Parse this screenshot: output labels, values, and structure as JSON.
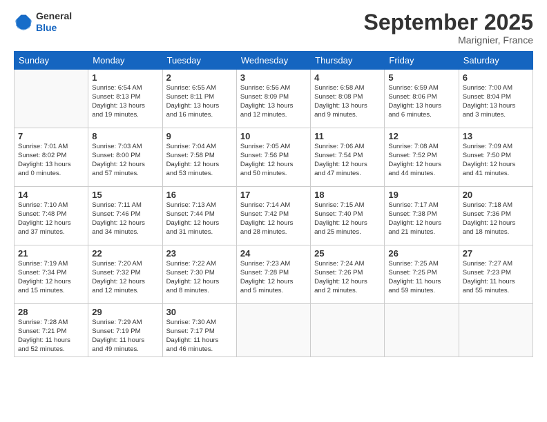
{
  "header": {
    "logo_line1": "General",
    "logo_line2": "Blue",
    "month_title": "September 2025",
    "subtitle": "Marignier, France"
  },
  "days_of_week": [
    "Sunday",
    "Monday",
    "Tuesday",
    "Wednesday",
    "Thursday",
    "Friday",
    "Saturday"
  ],
  "weeks": [
    [
      {
        "day": "",
        "info": ""
      },
      {
        "day": "1",
        "info": "Sunrise: 6:54 AM\nSunset: 8:13 PM\nDaylight: 13 hours\nand 19 minutes."
      },
      {
        "day": "2",
        "info": "Sunrise: 6:55 AM\nSunset: 8:11 PM\nDaylight: 13 hours\nand 16 minutes."
      },
      {
        "day": "3",
        "info": "Sunrise: 6:56 AM\nSunset: 8:09 PM\nDaylight: 13 hours\nand 12 minutes."
      },
      {
        "day": "4",
        "info": "Sunrise: 6:58 AM\nSunset: 8:08 PM\nDaylight: 13 hours\nand 9 minutes."
      },
      {
        "day": "5",
        "info": "Sunrise: 6:59 AM\nSunset: 8:06 PM\nDaylight: 13 hours\nand 6 minutes."
      },
      {
        "day": "6",
        "info": "Sunrise: 7:00 AM\nSunset: 8:04 PM\nDaylight: 13 hours\nand 3 minutes."
      }
    ],
    [
      {
        "day": "7",
        "info": "Sunrise: 7:01 AM\nSunset: 8:02 PM\nDaylight: 13 hours\nand 0 minutes."
      },
      {
        "day": "8",
        "info": "Sunrise: 7:03 AM\nSunset: 8:00 PM\nDaylight: 12 hours\nand 57 minutes."
      },
      {
        "day": "9",
        "info": "Sunrise: 7:04 AM\nSunset: 7:58 PM\nDaylight: 12 hours\nand 53 minutes."
      },
      {
        "day": "10",
        "info": "Sunrise: 7:05 AM\nSunset: 7:56 PM\nDaylight: 12 hours\nand 50 minutes."
      },
      {
        "day": "11",
        "info": "Sunrise: 7:06 AM\nSunset: 7:54 PM\nDaylight: 12 hours\nand 47 minutes."
      },
      {
        "day": "12",
        "info": "Sunrise: 7:08 AM\nSunset: 7:52 PM\nDaylight: 12 hours\nand 44 minutes."
      },
      {
        "day": "13",
        "info": "Sunrise: 7:09 AM\nSunset: 7:50 PM\nDaylight: 12 hours\nand 41 minutes."
      }
    ],
    [
      {
        "day": "14",
        "info": "Sunrise: 7:10 AM\nSunset: 7:48 PM\nDaylight: 12 hours\nand 37 minutes."
      },
      {
        "day": "15",
        "info": "Sunrise: 7:11 AM\nSunset: 7:46 PM\nDaylight: 12 hours\nand 34 minutes."
      },
      {
        "day": "16",
        "info": "Sunrise: 7:13 AM\nSunset: 7:44 PM\nDaylight: 12 hours\nand 31 minutes."
      },
      {
        "day": "17",
        "info": "Sunrise: 7:14 AM\nSunset: 7:42 PM\nDaylight: 12 hours\nand 28 minutes."
      },
      {
        "day": "18",
        "info": "Sunrise: 7:15 AM\nSunset: 7:40 PM\nDaylight: 12 hours\nand 25 minutes."
      },
      {
        "day": "19",
        "info": "Sunrise: 7:17 AM\nSunset: 7:38 PM\nDaylight: 12 hours\nand 21 minutes."
      },
      {
        "day": "20",
        "info": "Sunrise: 7:18 AM\nSunset: 7:36 PM\nDaylight: 12 hours\nand 18 minutes."
      }
    ],
    [
      {
        "day": "21",
        "info": "Sunrise: 7:19 AM\nSunset: 7:34 PM\nDaylight: 12 hours\nand 15 minutes."
      },
      {
        "day": "22",
        "info": "Sunrise: 7:20 AM\nSunset: 7:32 PM\nDaylight: 12 hours\nand 12 minutes."
      },
      {
        "day": "23",
        "info": "Sunrise: 7:22 AM\nSunset: 7:30 PM\nDaylight: 12 hours\nand 8 minutes."
      },
      {
        "day": "24",
        "info": "Sunrise: 7:23 AM\nSunset: 7:28 PM\nDaylight: 12 hours\nand 5 minutes."
      },
      {
        "day": "25",
        "info": "Sunrise: 7:24 AM\nSunset: 7:26 PM\nDaylight: 12 hours\nand 2 minutes."
      },
      {
        "day": "26",
        "info": "Sunrise: 7:25 AM\nSunset: 7:25 PM\nDaylight: 11 hours\nand 59 minutes."
      },
      {
        "day": "27",
        "info": "Sunrise: 7:27 AM\nSunset: 7:23 PM\nDaylight: 11 hours\nand 55 minutes."
      }
    ],
    [
      {
        "day": "28",
        "info": "Sunrise: 7:28 AM\nSunset: 7:21 PM\nDaylight: 11 hours\nand 52 minutes."
      },
      {
        "day": "29",
        "info": "Sunrise: 7:29 AM\nSunset: 7:19 PM\nDaylight: 11 hours\nand 49 minutes."
      },
      {
        "day": "30",
        "info": "Sunrise: 7:30 AM\nSunset: 7:17 PM\nDaylight: 11 hours\nand 46 minutes."
      },
      {
        "day": "",
        "info": ""
      },
      {
        "day": "",
        "info": ""
      },
      {
        "day": "",
        "info": ""
      },
      {
        "day": "",
        "info": ""
      }
    ]
  ]
}
